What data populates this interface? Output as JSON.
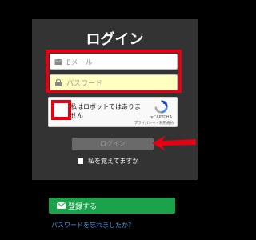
{
  "login_card": {
    "title": "ログイン",
    "email": {
      "placeholder": "Eメール",
      "icon": "envelope-icon"
    },
    "password": {
      "placeholder": "パスワード",
      "icon": "lock-icon"
    },
    "captcha": {
      "label": "私はロボットではありません",
      "brand": "reCAPTCHA",
      "links": "プライバシー・利用規約",
      "icon": "recaptcha-logo-icon"
    },
    "login_button": "ログイン",
    "remember_label": "私を覚えてますか"
  },
  "register_button": {
    "label": "登録する",
    "icon": "envelope-icon"
  },
  "forgot_password_link": "パスワードを忘れましたか?",
  "colors": {
    "background": "#000000",
    "card": "#333333",
    "highlight": "#e60012",
    "register": "#1aa34a",
    "link": "#4a9ae8"
  }
}
